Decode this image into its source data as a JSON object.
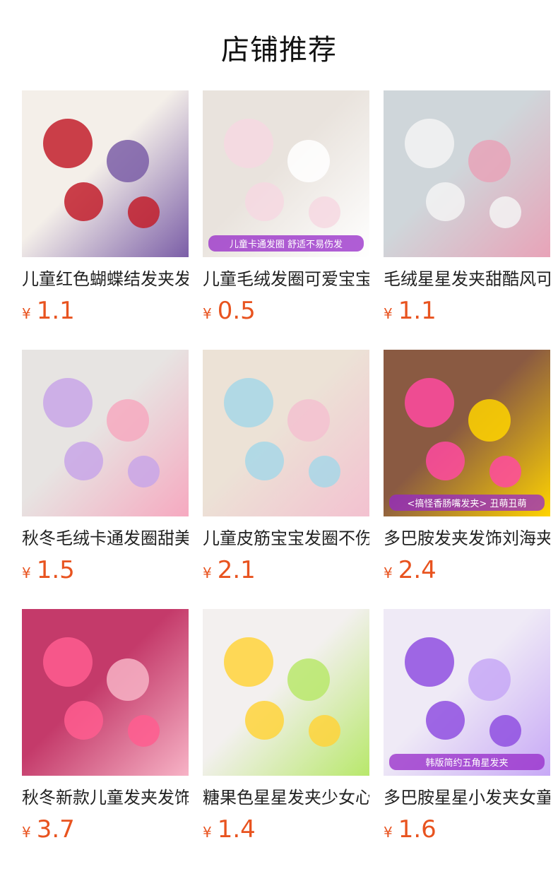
{
  "section": {
    "title": "店铺推荐"
  },
  "products": [
    {
      "name": "儿童红色蝴蝶结发夹发饰",
      "currency": "¥",
      "price": "1.1",
      "colors": [
        "#f4efe9",
        "#c21f2c",
        "#7b5ea7"
      ],
      "overlay": ""
    },
    {
      "name": "儿童毛绒发圈可爱宝宝头绳",
      "currency": "¥",
      "price": "0.5",
      "colors": [
        "#e9e3dd",
        "#f6d8e2",
        "#ffffff"
      ],
      "overlay": "儿童卡通发圈 舒适不易伤发"
    },
    {
      "name": "毛绒星星发夹甜酷风可爱",
      "currency": "¥",
      "price": "1.1",
      "colors": [
        "#cfd6da",
        "#f3f3f3",
        "#e8a3b8"
      ],
      "overlay": ""
    },
    {
      "name": "秋冬毛绒卡通发圈甜美可爱",
      "currency": "¥",
      "price": "1.5",
      "colors": [
        "#e7e4e2",
        "#c8a6e8",
        "#f6a9c0"
      ],
      "overlay": ""
    },
    {
      "name": "儿童皮筋宝宝发圈不伤发",
      "currency": "¥",
      "price": "2.1",
      "colors": [
        "#ece2d6",
        "#a7d7e8",
        "#f3c1d0"
      ],
      "overlay": ""
    },
    {
      "name": "多巴胺发夹发饰刘海夹",
      "currency": "¥",
      "price": "2.4",
      "colors": [
        "#8a5a42",
        "#ff4aa0",
        "#ffd400"
      ],
      "overlay": "<搞怪香肠嘴发夹> 丑萌丑萌"
    },
    {
      "name": "秋冬新款儿童发夹发饰",
      "currency": "¥",
      "price": "3.7",
      "colors": [
        "#c43a6a",
        "#ff5d8f",
        "#f7b3c6"
      ],
      "overlay": ""
    },
    {
      "name": "糖果色星星发夹少女心",
      "currency": "¥",
      "price": "1.4",
      "colors": [
        "#f3f0ef",
        "#ffd33b",
        "#b8e86b"
      ],
      "overlay": ""
    },
    {
      "name": "多巴胺星星小发夹女童",
      "currency": "¥",
      "price": "1.6",
      "colors": [
        "#efeaf6",
        "#8f4fe0",
        "#c7a8f6"
      ],
      "overlay": "韩版简约五角星发夹"
    }
  ]
}
